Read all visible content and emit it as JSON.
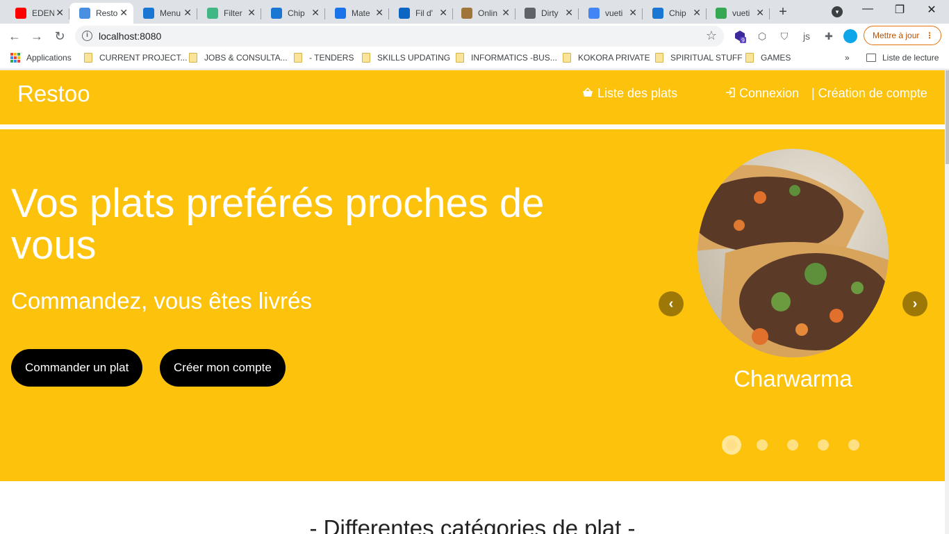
{
  "browser": {
    "tabs": [
      {
        "title": "EDEN",
        "icon": "youtube-icon",
        "color": "#ff0000"
      },
      {
        "title": "Resto",
        "icon": "page-icon",
        "color": "#4a90e2"
      },
      {
        "title": "Menu",
        "icon": "vuetify-icon",
        "color": "#1976d2"
      },
      {
        "title": "Filter",
        "icon": "vue-icon",
        "color": "#41b883"
      },
      {
        "title": "Chip",
        "icon": "vuetify-icon",
        "color": "#1976d2"
      },
      {
        "title": "Mate",
        "icon": "material-icon",
        "color": "#1a73e8"
      },
      {
        "title": "Fil d'",
        "icon": "linkedin-icon",
        "color": "#0a66c2"
      },
      {
        "title": "Onlin",
        "icon": "box-icon",
        "color": "#a0753a"
      },
      {
        "title": "Dirty",
        "icon": "code-icon",
        "color": "#5f6368"
      },
      {
        "title": "vueti",
        "icon": "google-icon",
        "color": "#4285f4"
      },
      {
        "title": "Chip",
        "icon": "vuetify-icon",
        "color": "#1976d2"
      },
      {
        "title": "vueti",
        "icon": "sparkle-icon",
        "color": "#34a853"
      }
    ],
    "address": "localhost:8080",
    "update_button": "Mettre à jour",
    "badge_count": "9"
  },
  "bookmarks": {
    "apps": "Applications",
    "items": [
      "CURRENT PROJECT...",
      "JOBS & CONSULTA...",
      "- TENDERS",
      "SKILLS UPDATING",
      "INFORMATICS -BUS...",
      "KOKORA PRIVATE",
      "SPIRITUAL STUFF",
      "GAMES"
    ],
    "reading_list": "Liste de lecture"
  },
  "site": {
    "brand": "Restoo",
    "nav": {
      "dishes": "Liste des plats",
      "login": "Connexion",
      "signup": "| Création de compte"
    },
    "hero": {
      "title": "Vos plats preférés proches de vous",
      "subtitle": "Commandez, vous êtes livrés",
      "order_button": "Commander un plat",
      "account_button": "Créer mon compte"
    },
    "carousel": {
      "caption": "Charwarma",
      "slides": 5,
      "active_index": 0
    },
    "section_title": "- Differentes catégories de plat -"
  },
  "colors": {
    "brand_yellow": "#fdc20b",
    "button_black": "#000000"
  }
}
